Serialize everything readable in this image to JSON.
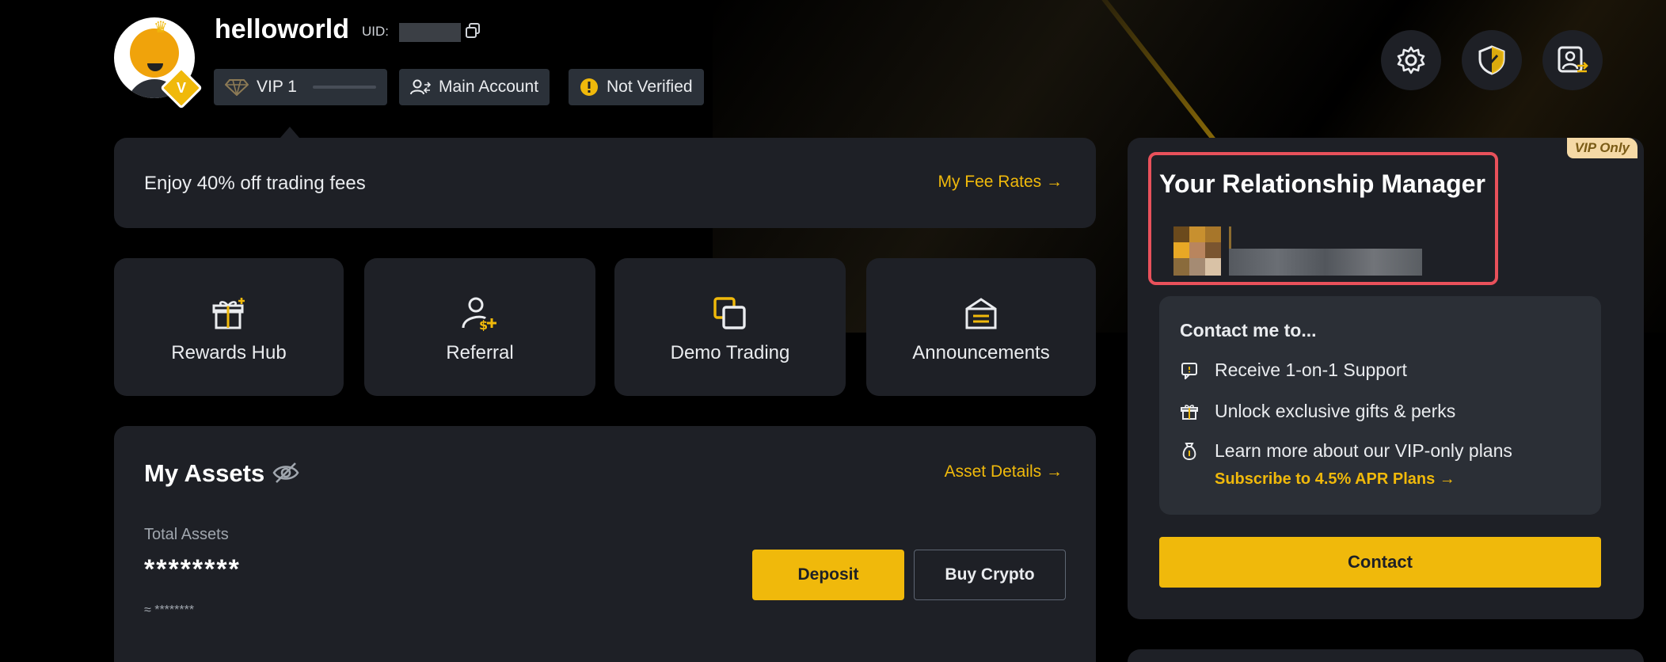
{
  "profile": {
    "username": "helloworld",
    "uid_label": "UID:",
    "avatar_badge": "V",
    "vip_label": "VIP 1",
    "account_label": "Main Account",
    "verify_label": "Not Verified"
  },
  "fee": {
    "text": "Enjoy 40% off trading fees",
    "link": "My Fee Rates →"
  },
  "shortcuts": [
    {
      "label": "Rewards Hub"
    },
    {
      "label": "Referral"
    },
    {
      "label": "Demo Trading"
    },
    {
      "label": "Announcements"
    }
  ],
  "assets": {
    "title": "My Assets",
    "details_link": "Asset Details →",
    "total_label": "Total Assets",
    "total_value": "********",
    "approx_value": "≈ ********",
    "deposit_label": "Deposit",
    "buy_label": "Buy Crypto"
  },
  "relationship_manager": {
    "vip_tag": "VIP Only",
    "title": "Your Relationship Manager",
    "contact_heading": "Contact me to...",
    "items": [
      {
        "label": "Receive 1-on-1 Support"
      },
      {
        "label": "Unlock exclusive gifts & perks"
      },
      {
        "label": "Learn more about our VIP-only plans"
      }
    ],
    "subscribe_link": "Subscribe to 4.5% APR Plans →",
    "contact_button": "Contact"
  },
  "colors": {
    "accent": "#f0b90b",
    "panel": "#1e2026",
    "highlight": "#e9515b"
  }
}
